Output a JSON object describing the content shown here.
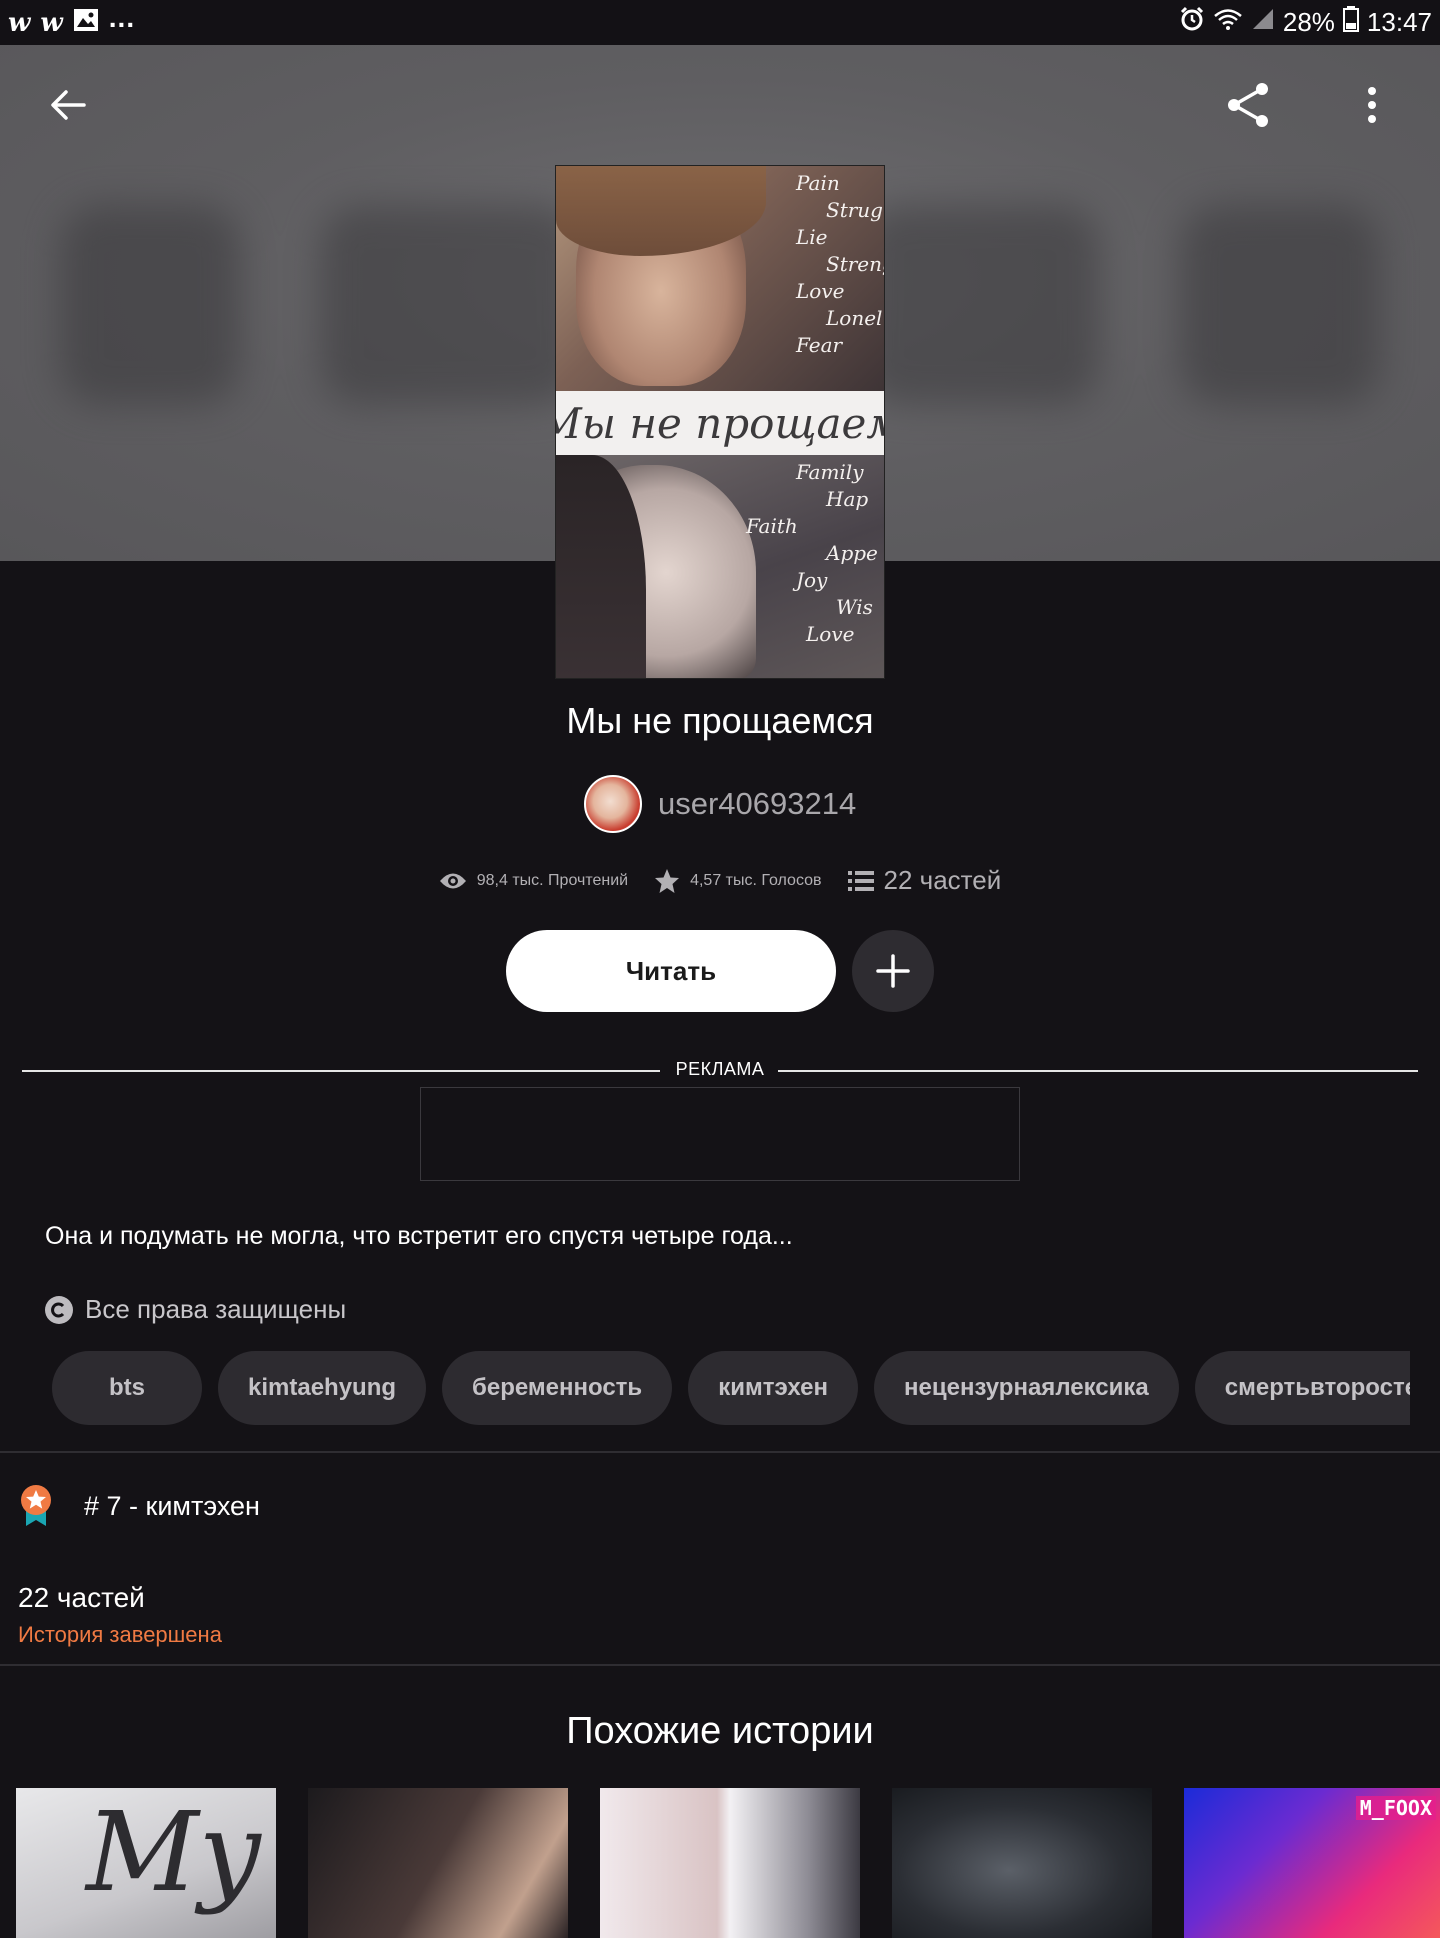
{
  "status_bar": {
    "left_icons": [
      "wattpad-icon",
      "wattpad-icon",
      "image-icon"
    ],
    "app_letter": "w",
    "overflow": "...",
    "battery": "28%",
    "time": "13:47"
  },
  "story": {
    "cover_title": "Мы не прощаем",
    "cover_words_top": [
      "Pain",
      "Strug",
      "Lie",
      "Streng",
      "Love",
      "Lonel",
      "Fear"
    ],
    "cover_words_bottom": [
      "Family",
      "Hap",
      "Faith",
      "Appe",
      "Joy",
      "Wis",
      "Love"
    ],
    "title": "Мы не прощаемся",
    "author": "user40693214",
    "stats": {
      "reads": "98,4 тыс. Прочтений",
      "votes": "4,57 тыс. Голосов",
      "parts": "22 частей"
    },
    "read_button": "Читать",
    "ad_label": "РЕКЛАМА",
    "description": "Она и подумать не могла, что встретит его спустя четыре года...",
    "rights": "Все права защищены",
    "tags": [
      "bts",
      "kimtaehyung",
      "беременность",
      "кимтэхен",
      "нецензурнаялексика",
      "смертьвторостепе"
    ],
    "rank": "# 7 - кимтэхен",
    "parts_count": "22 частей",
    "completion_status": "История завершена"
  },
  "similar": {
    "title": "Похожие истории",
    "thumb_1_text": "Му",
    "thumb_5_text": "M_FOOX"
  },
  "colors": {
    "background": "#141216",
    "accent": "#f07a43",
    "tag_bg": "#2d2b30"
  }
}
